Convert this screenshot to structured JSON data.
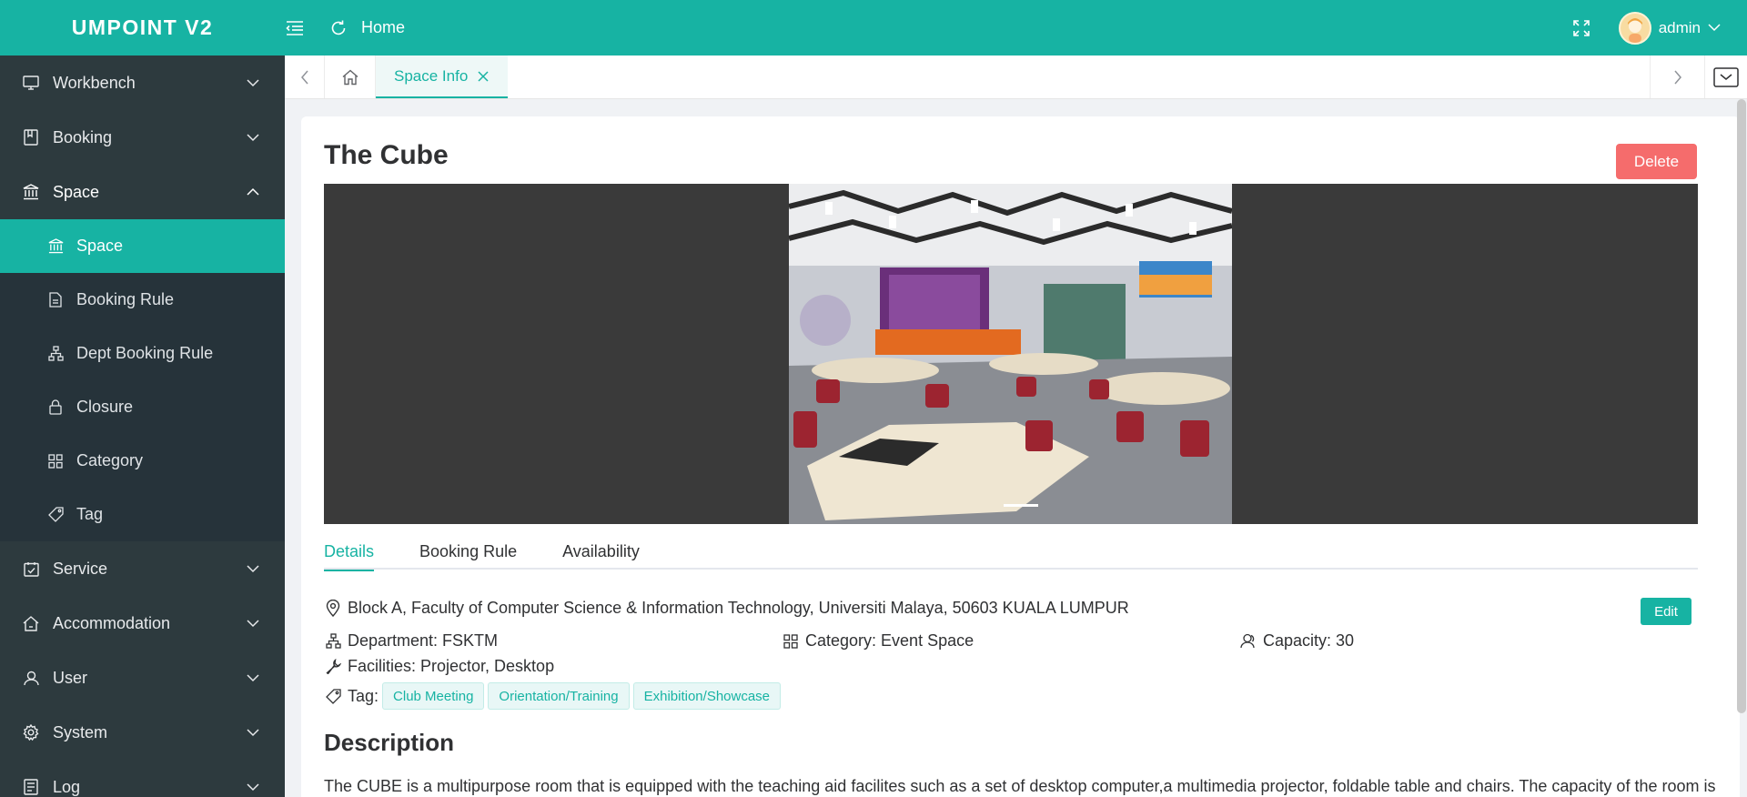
{
  "app": {
    "logo": "UMPOINT V2",
    "home_label": "Home",
    "user_name": "admin"
  },
  "sidebar": {
    "workbench": "Workbench",
    "booking": "Booking",
    "space": "Space",
    "space_sub": {
      "space": "Space",
      "booking_rule": "Booking Rule",
      "dept_booking_rule": "Dept Booking Rule",
      "closure": "Closure",
      "category": "Category",
      "tag": "Tag"
    },
    "service": "Service",
    "accommodation": "Accommodation",
    "user": "User",
    "system": "System",
    "log": "Log"
  },
  "tabs": {
    "active_label": "Space Info"
  },
  "page": {
    "title": "The Cube",
    "delete_label": "Delete",
    "detail_tabs": [
      "Details",
      "Booking Rule",
      "Availability"
    ],
    "address": "Block A, Faculty of Computer Science & Information Technology, Universiti Malaya, 50603 KUALA LUMPUR",
    "edit_label": "Edit",
    "department": "Department: FSKTM",
    "category": "Category: Event Space",
    "capacity": "Capacity: 30",
    "facilities": "Facilities: Projector, Desktop",
    "tag_label": "Tag:",
    "tags": [
      "Club Meeting",
      "Orientation/Training",
      "Exhibition/Showcase"
    ],
    "description_title": "Description",
    "description_text": "The CUBE is a multipurpose room that is equipped with the teaching aid facilites such as a set of desktop computer,a multimedia projector, foldable table and chairs. The capacity of the room is"
  },
  "colors": {
    "primary": "#17b3a3",
    "sidebar_bg": "#2d3a3e",
    "danger": "#f56c6c"
  }
}
